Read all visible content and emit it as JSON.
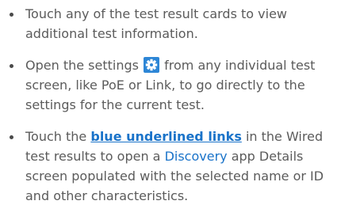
{
  "tips": [
    {
      "text": "Touch any of the test result cards to view additional test information."
    },
    {
      "text_before": "Open the settings",
      "icon": "gear-icon",
      "text_after": "from any individual test screen, like PoE or Link, to go directly to the settings for the current test."
    },
    {
      "text_before": "Touch the",
      "link_strong": "blue underlined links",
      "text_middle": "in the Wired test results to open a",
      "link_plain": "Discovery",
      "text_after": "app Details screen populated with the selected name or ID and other characteristics."
    }
  ],
  "colors": {
    "text": "#5b5b5b",
    "link": "#1a73c9",
    "icon_bg": "#2d86d6"
  }
}
